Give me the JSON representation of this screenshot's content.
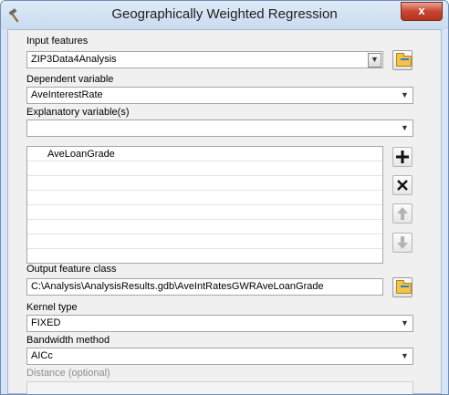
{
  "window": {
    "title": "Geographically Weighted Regression",
    "close_glyph": "x"
  },
  "icons": {
    "app": "hammer-icon",
    "browse": "folder-open-icon",
    "add": "plus-icon",
    "remove": "x-icon",
    "up": "arrow-up-icon",
    "down": "arrow-down-icon"
  },
  "input_features": {
    "label": "Input features",
    "value": "ZIP3Data4Analysis"
  },
  "dependent_variable": {
    "label": "Dependent variable",
    "value": "AveInterestRate"
  },
  "explanatory_variables": {
    "label": "Explanatory variable(s)",
    "value": "",
    "list": [
      "AveLoanGrade",
      "",
      "",
      "",
      "",
      "",
      "",
      ""
    ]
  },
  "output_feature_class": {
    "label": "Output feature class",
    "value": "C:\\Analysis\\AnalysisResults.gdb\\AveIntRatesGWRAveLoanGrade"
  },
  "kernel_type": {
    "label": "Kernel type",
    "value": "FIXED"
  },
  "bandwidth_method": {
    "label": "Bandwidth method",
    "value": "AICc"
  },
  "distance": {
    "label": "Distance (optional)",
    "value": ""
  },
  "colors": {
    "window_frame": "#d6e5f5",
    "client_background": "#f0f0f0",
    "close_button": "#c74530"
  }
}
